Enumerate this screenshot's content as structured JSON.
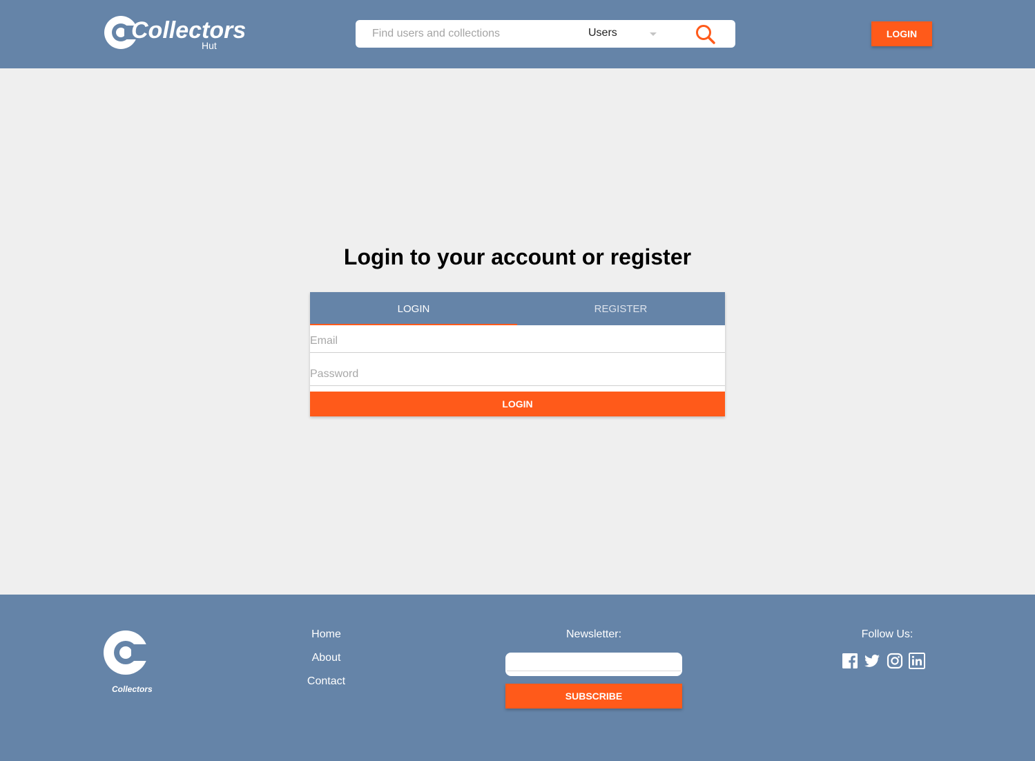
{
  "brand": {
    "name": "Collectors",
    "sub": "Hut",
    "footer_name": "Collectors"
  },
  "header": {
    "search": {
      "placeholder": "Find users and collections",
      "category": "Users",
      "icon": "search-icon"
    },
    "login_label": "LOGIN"
  },
  "main": {
    "title": "Login to your account or register",
    "tabs": [
      {
        "label": "LOGIN",
        "active": true
      },
      {
        "label": "REGISTER",
        "active": false
      }
    ],
    "email_placeholder": "Email",
    "password_placeholder": "Password",
    "submit_label": "LOGIN"
  },
  "footer": {
    "nav": [
      {
        "label": "Home"
      },
      {
        "label": "About"
      },
      {
        "label": "Contact"
      }
    ],
    "newsletter_title": "Newsletter:",
    "subscribe_label": "SUBSCRIBE",
    "follow_title": "Follow Us:",
    "social": [
      "facebook-icon",
      "twitter-icon",
      "instagram-icon",
      "linkedin-icon"
    ]
  },
  "colors": {
    "primary": "#6584a8",
    "accent": "#ff5a1a",
    "background": "#efefef"
  }
}
